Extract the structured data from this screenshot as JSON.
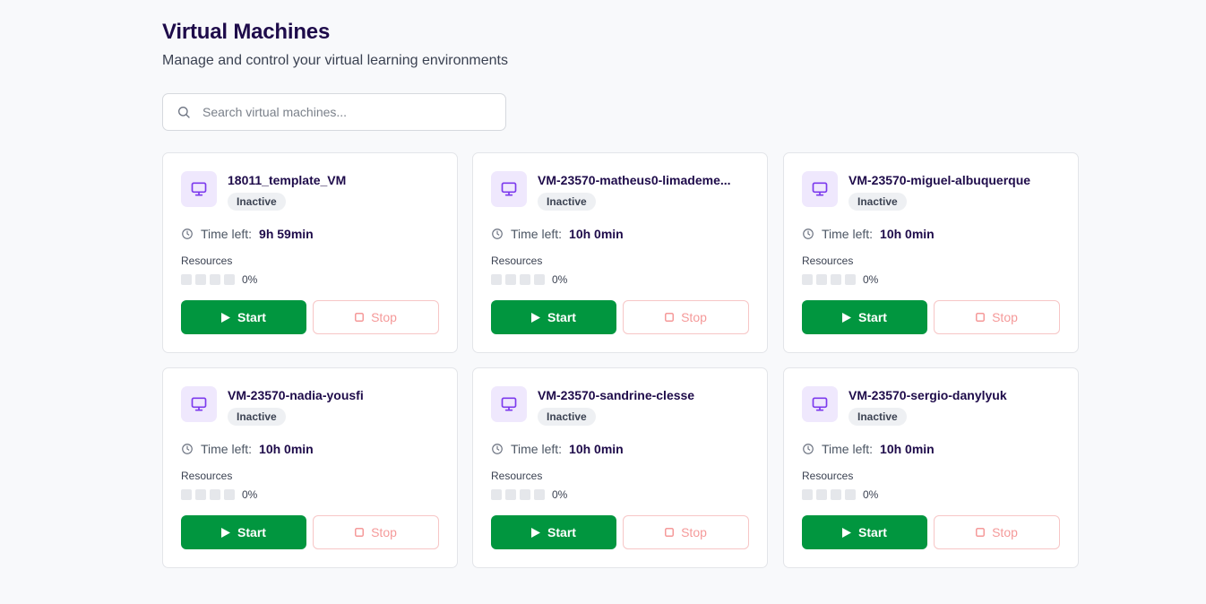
{
  "header": {
    "title": "Virtual Machines",
    "subtitle": "Manage and control your virtual learning environments"
  },
  "search": {
    "placeholder": "Search virtual machines...",
    "value": ""
  },
  "labels": {
    "time_left": "Time left:",
    "resources": "Resources",
    "start": "Start",
    "stop": "Stop"
  },
  "colors": {
    "start_button": "#01963f",
    "stop_button_text": "#f59a9a",
    "icon_accent": "#7c3aed",
    "icon_bg": "#efe8fd"
  },
  "vms": [
    {
      "name": "18011_template_VM",
      "status": "Inactive",
      "time_left": "9h 59min",
      "resources": "0%"
    },
    {
      "name": "VM-23570-matheus0-limademe...",
      "status": "Inactive",
      "time_left": "10h 0min",
      "resources": "0%"
    },
    {
      "name": "VM-23570-miguel-albuquerque",
      "status": "Inactive",
      "time_left": "10h 0min",
      "resources": "0%"
    },
    {
      "name": "VM-23570-nadia-yousfi",
      "status": "Inactive",
      "time_left": "10h 0min",
      "resources": "0%"
    },
    {
      "name": "VM-23570-sandrine-clesse",
      "status": "Inactive",
      "time_left": "10h 0min",
      "resources": "0%"
    },
    {
      "name": "VM-23570-sergio-danylyuk",
      "status": "Inactive",
      "time_left": "10h 0min",
      "resources": "0%"
    }
  ]
}
